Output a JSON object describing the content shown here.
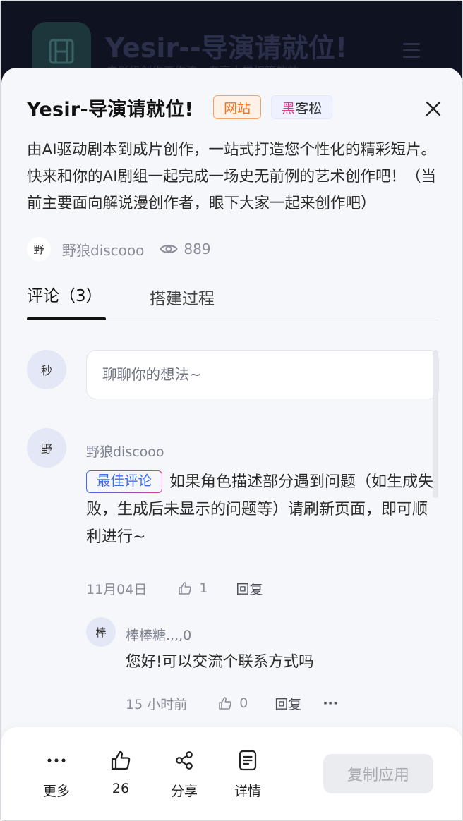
{
  "background": {
    "title": "Yesir--导演请就位!",
    "subtitle": "电影级创作工作流，专享本学权等效益"
  },
  "app": {
    "title": "Yesir-导演请就位!",
    "tag_site": "网站",
    "tag_hack_1": "黑",
    "tag_hack_2": "客松",
    "description": "由AI驱动剧本到成片创作，一站式打造您个性化的精彩短片。快来和你的AI剧组一起完成一场史无前例的艺术创作吧！（当前主要面向解说漫创作者，眼下大家一起来创作吧）",
    "author_avatar": "野",
    "author_name": "野狼discooo",
    "views": "889"
  },
  "tabs": {
    "comments": "评论（3）",
    "build": "搭建过程"
  },
  "comment_input": {
    "avatar": "秒",
    "placeholder": "聊聊你的想法~"
  },
  "comment": {
    "avatar": "野",
    "name": "野狼discooo",
    "badge": "最佳评论",
    "text": "如果角色描述部分遇到问题（如生成失败，生成后未显示的问题等）请刷新页面，即可顺利进行~",
    "date": "11月04日",
    "likes": "1",
    "reply": "回复"
  },
  "reply": {
    "avatar": "棒",
    "name": "棒棒糖.,,,0",
    "text": "您好!可以交流个联系方式吗",
    "time": "15 小时前",
    "likes": "0",
    "reply": "回复",
    "more": "···"
  },
  "bottom_bar": {
    "more": "更多",
    "likes": "26",
    "share": "分享",
    "details": "详情",
    "copy": "复制应用"
  }
}
